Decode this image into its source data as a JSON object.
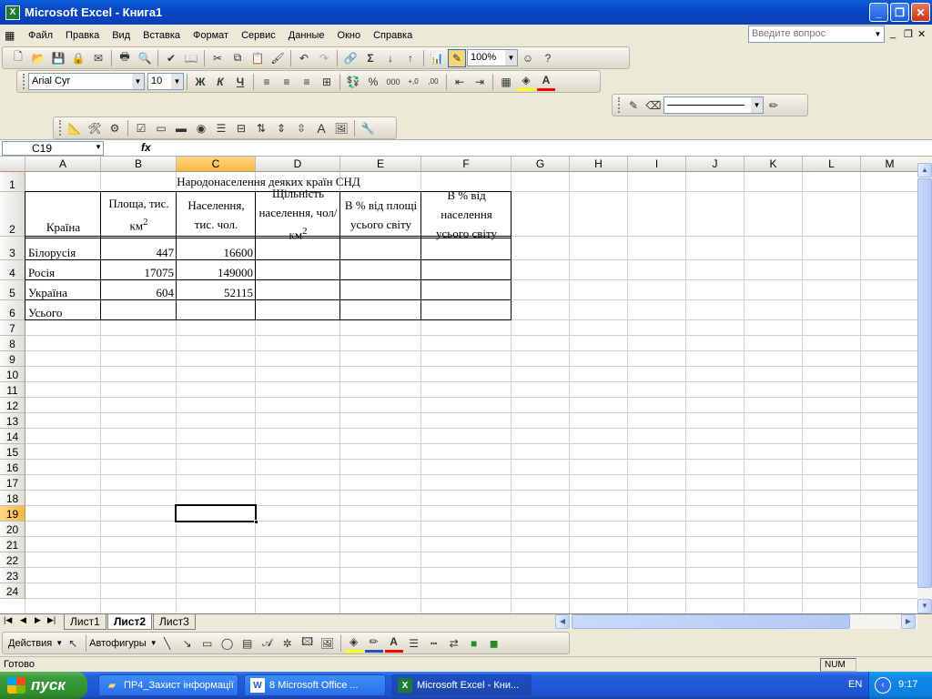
{
  "window": {
    "title": "Microsoft Excel - Книга1",
    "app_icon": "excel-icon"
  },
  "menu": {
    "items": [
      "Файл",
      "Правка",
      "Вид",
      "Вставка",
      "Формат",
      "Сервис",
      "Данные",
      "Окно",
      "Справка"
    ],
    "question_placeholder": "Введите вопрос"
  },
  "toolbar": {
    "zoom": "100%",
    "font_name": "Arial Cyr",
    "font_size": "10"
  },
  "formula_bar": {
    "cell_ref": "C19",
    "fx": "fx",
    "content": ""
  },
  "columns": [
    "A",
    "B",
    "C",
    "D",
    "E",
    "F",
    "G",
    "H",
    "I",
    "J",
    "K",
    "L",
    "M"
  ],
  "selected": {
    "column": "C",
    "row": "19"
  },
  "rows": [
    "1",
    "2",
    "3",
    "4",
    "5",
    "6",
    "7",
    "8",
    "9",
    "10",
    "11",
    "12",
    "13",
    "14",
    "15",
    "16",
    "17",
    "18",
    "19",
    "20",
    "21",
    "22",
    "23",
    "24"
  ],
  "sheet": {
    "title": "Народонаселення деяких країн СНД",
    "headers": {
      "a": "Країна",
      "b": "Площа, тис. км",
      "b_sup": "2",
      "c": "Населення, тис. чол.",
      "d": "Щільність населення, чол/км",
      "d_sup": "2",
      "e": "В % від площі усього світу",
      "f": "В % від населення усього світу"
    },
    "data": [
      {
        "country": "Білорусія",
        "area": "447",
        "population": "16600"
      },
      {
        "country": "Росія",
        "area": "17075",
        "population": "149000"
      },
      {
        "country": "Україна",
        "area": "604",
        "population": "52115"
      },
      {
        "country": "Усього",
        "area": "",
        "population": ""
      }
    ]
  },
  "tabs": [
    "Лист1",
    "Лист2",
    "Лист3"
  ],
  "active_tab": "Лист2",
  "drawing": {
    "actions": "Действия",
    "autoshapes": "Автофигуры"
  },
  "status": {
    "text": "Готово",
    "num": "NUM"
  },
  "taskbar": {
    "start": "пуск",
    "tasks": [
      "ПР4_Захист інформації",
      "8 Microsoft Office ...",
      "Microsoft Excel - Кни..."
    ],
    "lang": "EN",
    "time": "9:17"
  }
}
